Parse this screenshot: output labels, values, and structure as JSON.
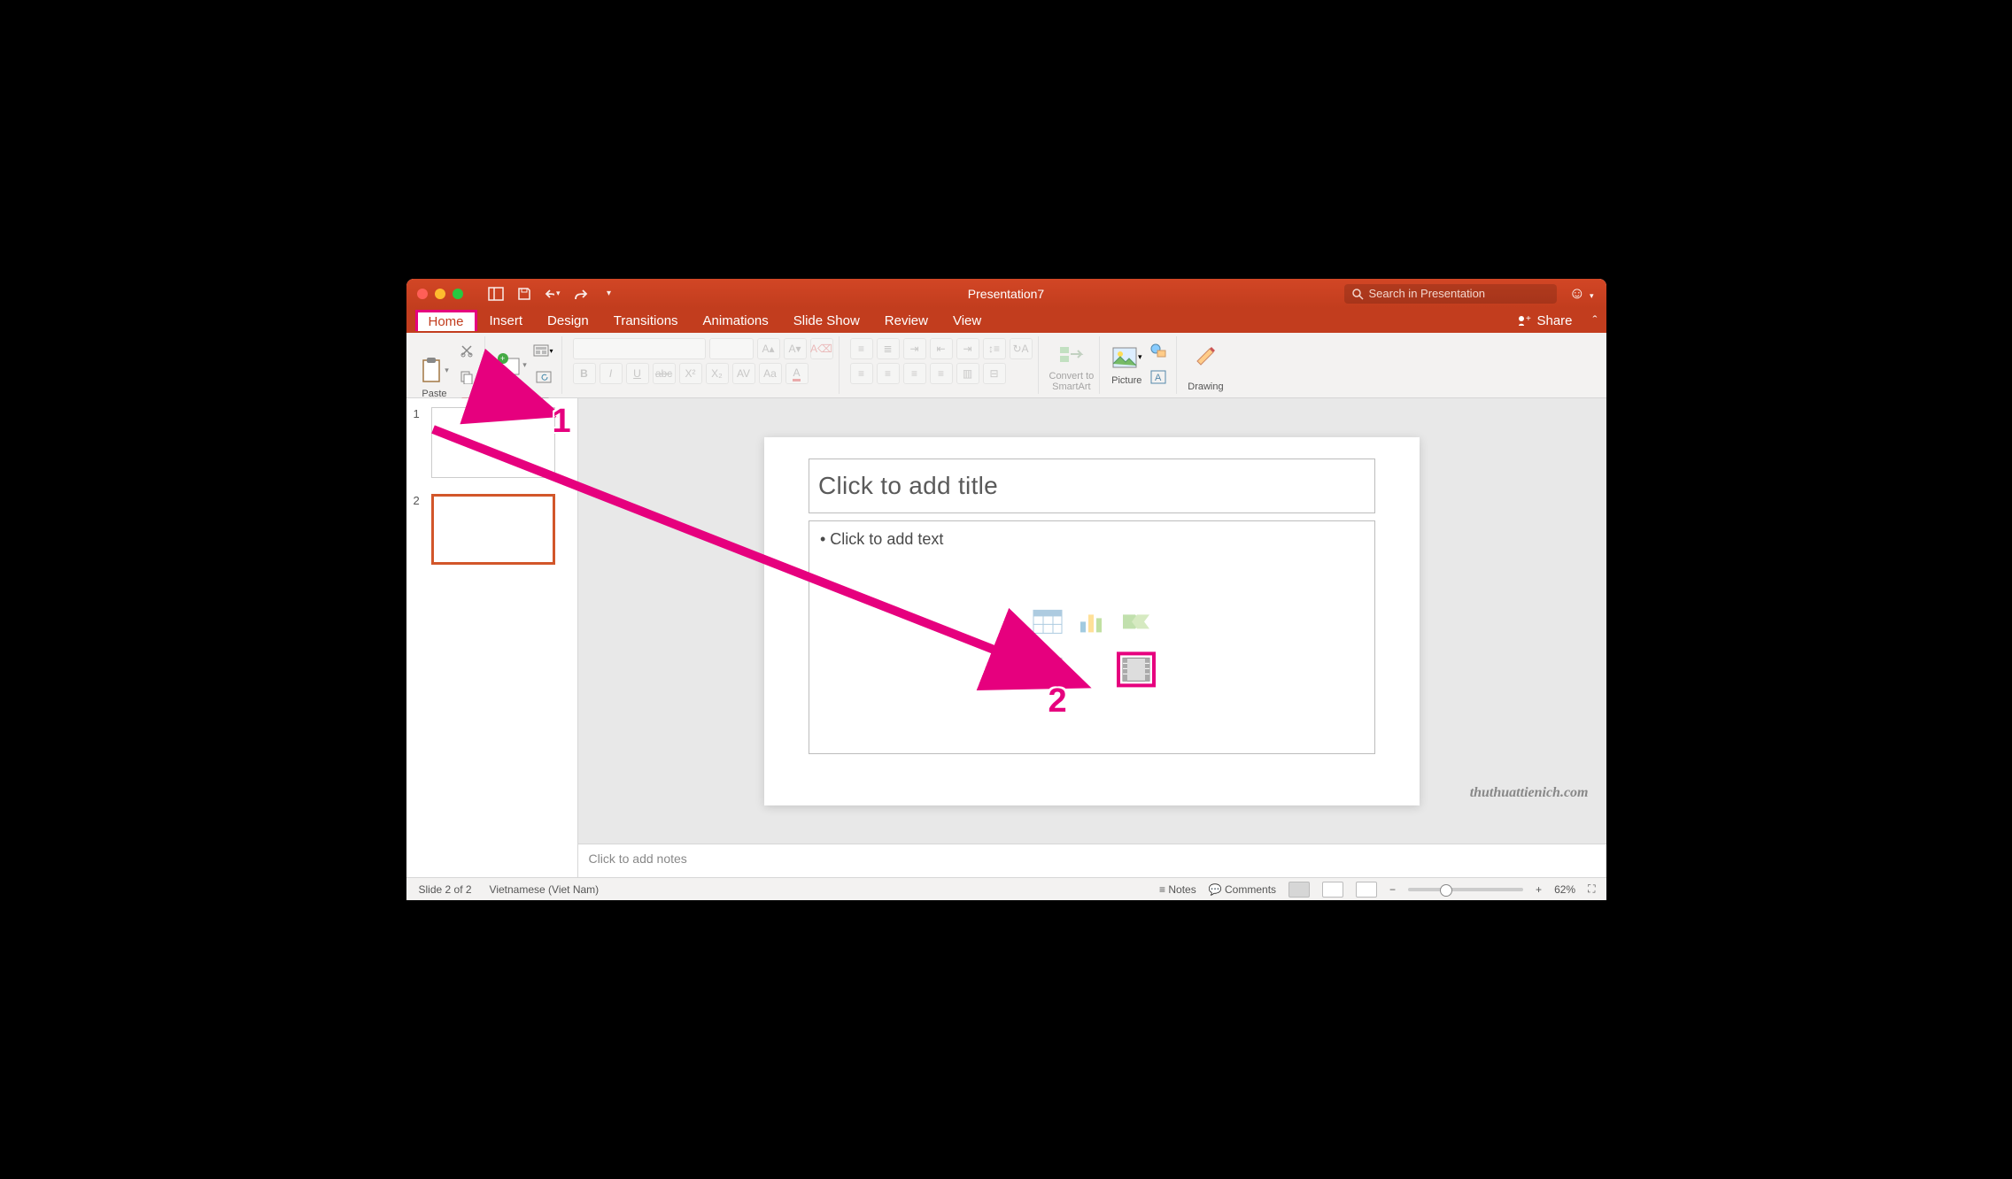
{
  "window": {
    "title": "Presentation7"
  },
  "search": {
    "placeholder": "Search in Presentation"
  },
  "tabs": [
    "Home",
    "Insert",
    "Design",
    "Transitions",
    "Animations",
    "Slide Show",
    "Review",
    "View"
  ],
  "share_label": "Share",
  "ribbon": {
    "paste": "Paste",
    "new_slide": "New\nSlide",
    "convert": "Convert to\nSmartArt",
    "picture": "Picture",
    "drawing": "Drawing"
  },
  "thumbs": [
    {
      "num": "1",
      "selected": false
    },
    {
      "num": "2",
      "selected": true
    }
  ],
  "slide": {
    "title_placeholder": "Click to add title",
    "text_placeholder": "• Click to add text"
  },
  "notes_placeholder": "Click to add notes",
  "status": {
    "slide": "Slide 2 of 2",
    "lang": "Vietnamese (Viet Nam)",
    "notes": "Notes",
    "comments": "Comments",
    "zoom": "62%"
  },
  "watermark": "thuthuattienich.com",
  "annotations": {
    "one": "1",
    "two": "2"
  }
}
